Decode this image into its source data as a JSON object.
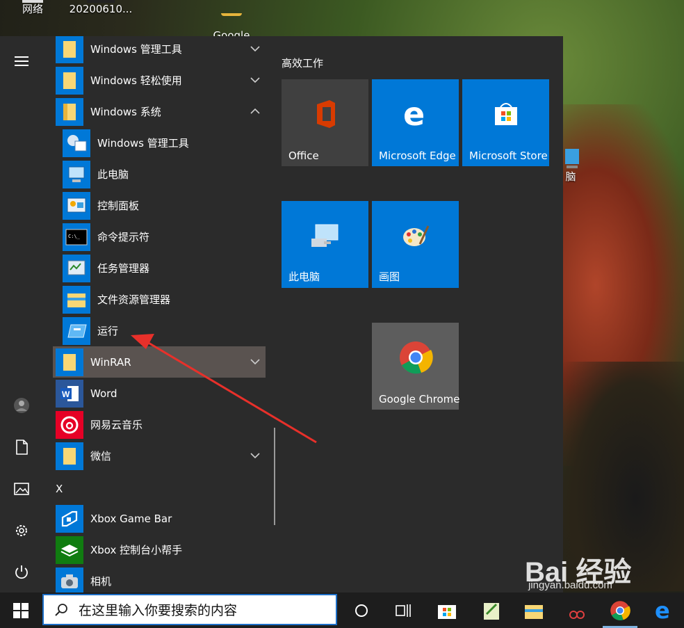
{
  "desktop": {
    "icons": [
      {
        "label": "网络"
      },
      {
        "label": "20200610..."
      },
      {
        "label": "Google\nChrome"
      },
      {
        "label": "脑"
      }
    ]
  },
  "start_menu": {
    "rail": {
      "hamburger": "hamburger-icon",
      "avatar": "avatar-icon",
      "documents": "document-icon",
      "pictures": "pictures-icon",
      "settings": "gear-icon",
      "power": "power-icon"
    },
    "app_list": {
      "items": [
        {
          "label": "Windows 管理工具",
          "type": "folder",
          "chevron": "down"
        },
        {
          "label": "Windows 轻松使用",
          "type": "folder",
          "chevron": "down"
        },
        {
          "label": "Windows 系统",
          "type": "folder",
          "chevron": "up"
        },
        {
          "label": "Windows 管理工具",
          "type": "sub"
        },
        {
          "label": "此电脑",
          "type": "sub"
        },
        {
          "label": "控制面板",
          "type": "sub"
        },
        {
          "label": "命令提示符",
          "type": "sub"
        },
        {
          "label": "任务管理器",
          "type": "sub"
        },
        {
          "label": "文件资源管理器",
          "type": "sub"
        },
        {
          "label": "运行",
          "type": "sub"
        },
        {
          "label": "WinRAR",
          "type": "folder",
          "chevron": "down"
        },
        {
          "label": "Word",
          "type": "app"
        },
        {
          "label": "网易云音乐",
          "type": "app"
        },
        {
          "label": "微信",
          "type": "folder",
          "chevron": "down"
        },
        {
          "label": "Xbox Game Bar",
          "type": "app"
        },
        {
          "label": "Xbox 控制台小帮手",
          "type": "app"
        },
        {
          "label": "相机",
          "type": "app"
        }
      ],
      "section_letter": "X"
    },
    "tiles": {
      "group_title": "高效工作",
      "items": [
        {
          "label": "Office"
        },
        {
          "label": "Microsoft Edge"
        },
        {
          "label": "Microsoft Store"
        },
        {
          "label": "此电脑"
        },
        {
          "label": "画图"
        },
        {
          "label": "Google Chrome"
        }
      ]
    }
  },
  "taskbar": {
    "search_placeholder": "在这里输入你要搜索的内容",
    "buttons": [
      "windows-logo-icon",
      "cortana-icon",
      "task-view-icon",
      "store-icon",
      "notepad-icon",
      "file-explorer-icon",
      "snipping-icon",
      "chrome-icon",
      "edge-icon"
    ]
  },
  "watermark": {
    "brand": "Bai 经验",
    "url": "jingyan.baidu.com"
  },
  "colors": {
    "accent": "#0078d7",
    "menu_bg": "#2b2b2b",
    "highlight": "#5a5350",
    "folder": "#f8d775",
    "arrow": "#e8302a"
  }
}
